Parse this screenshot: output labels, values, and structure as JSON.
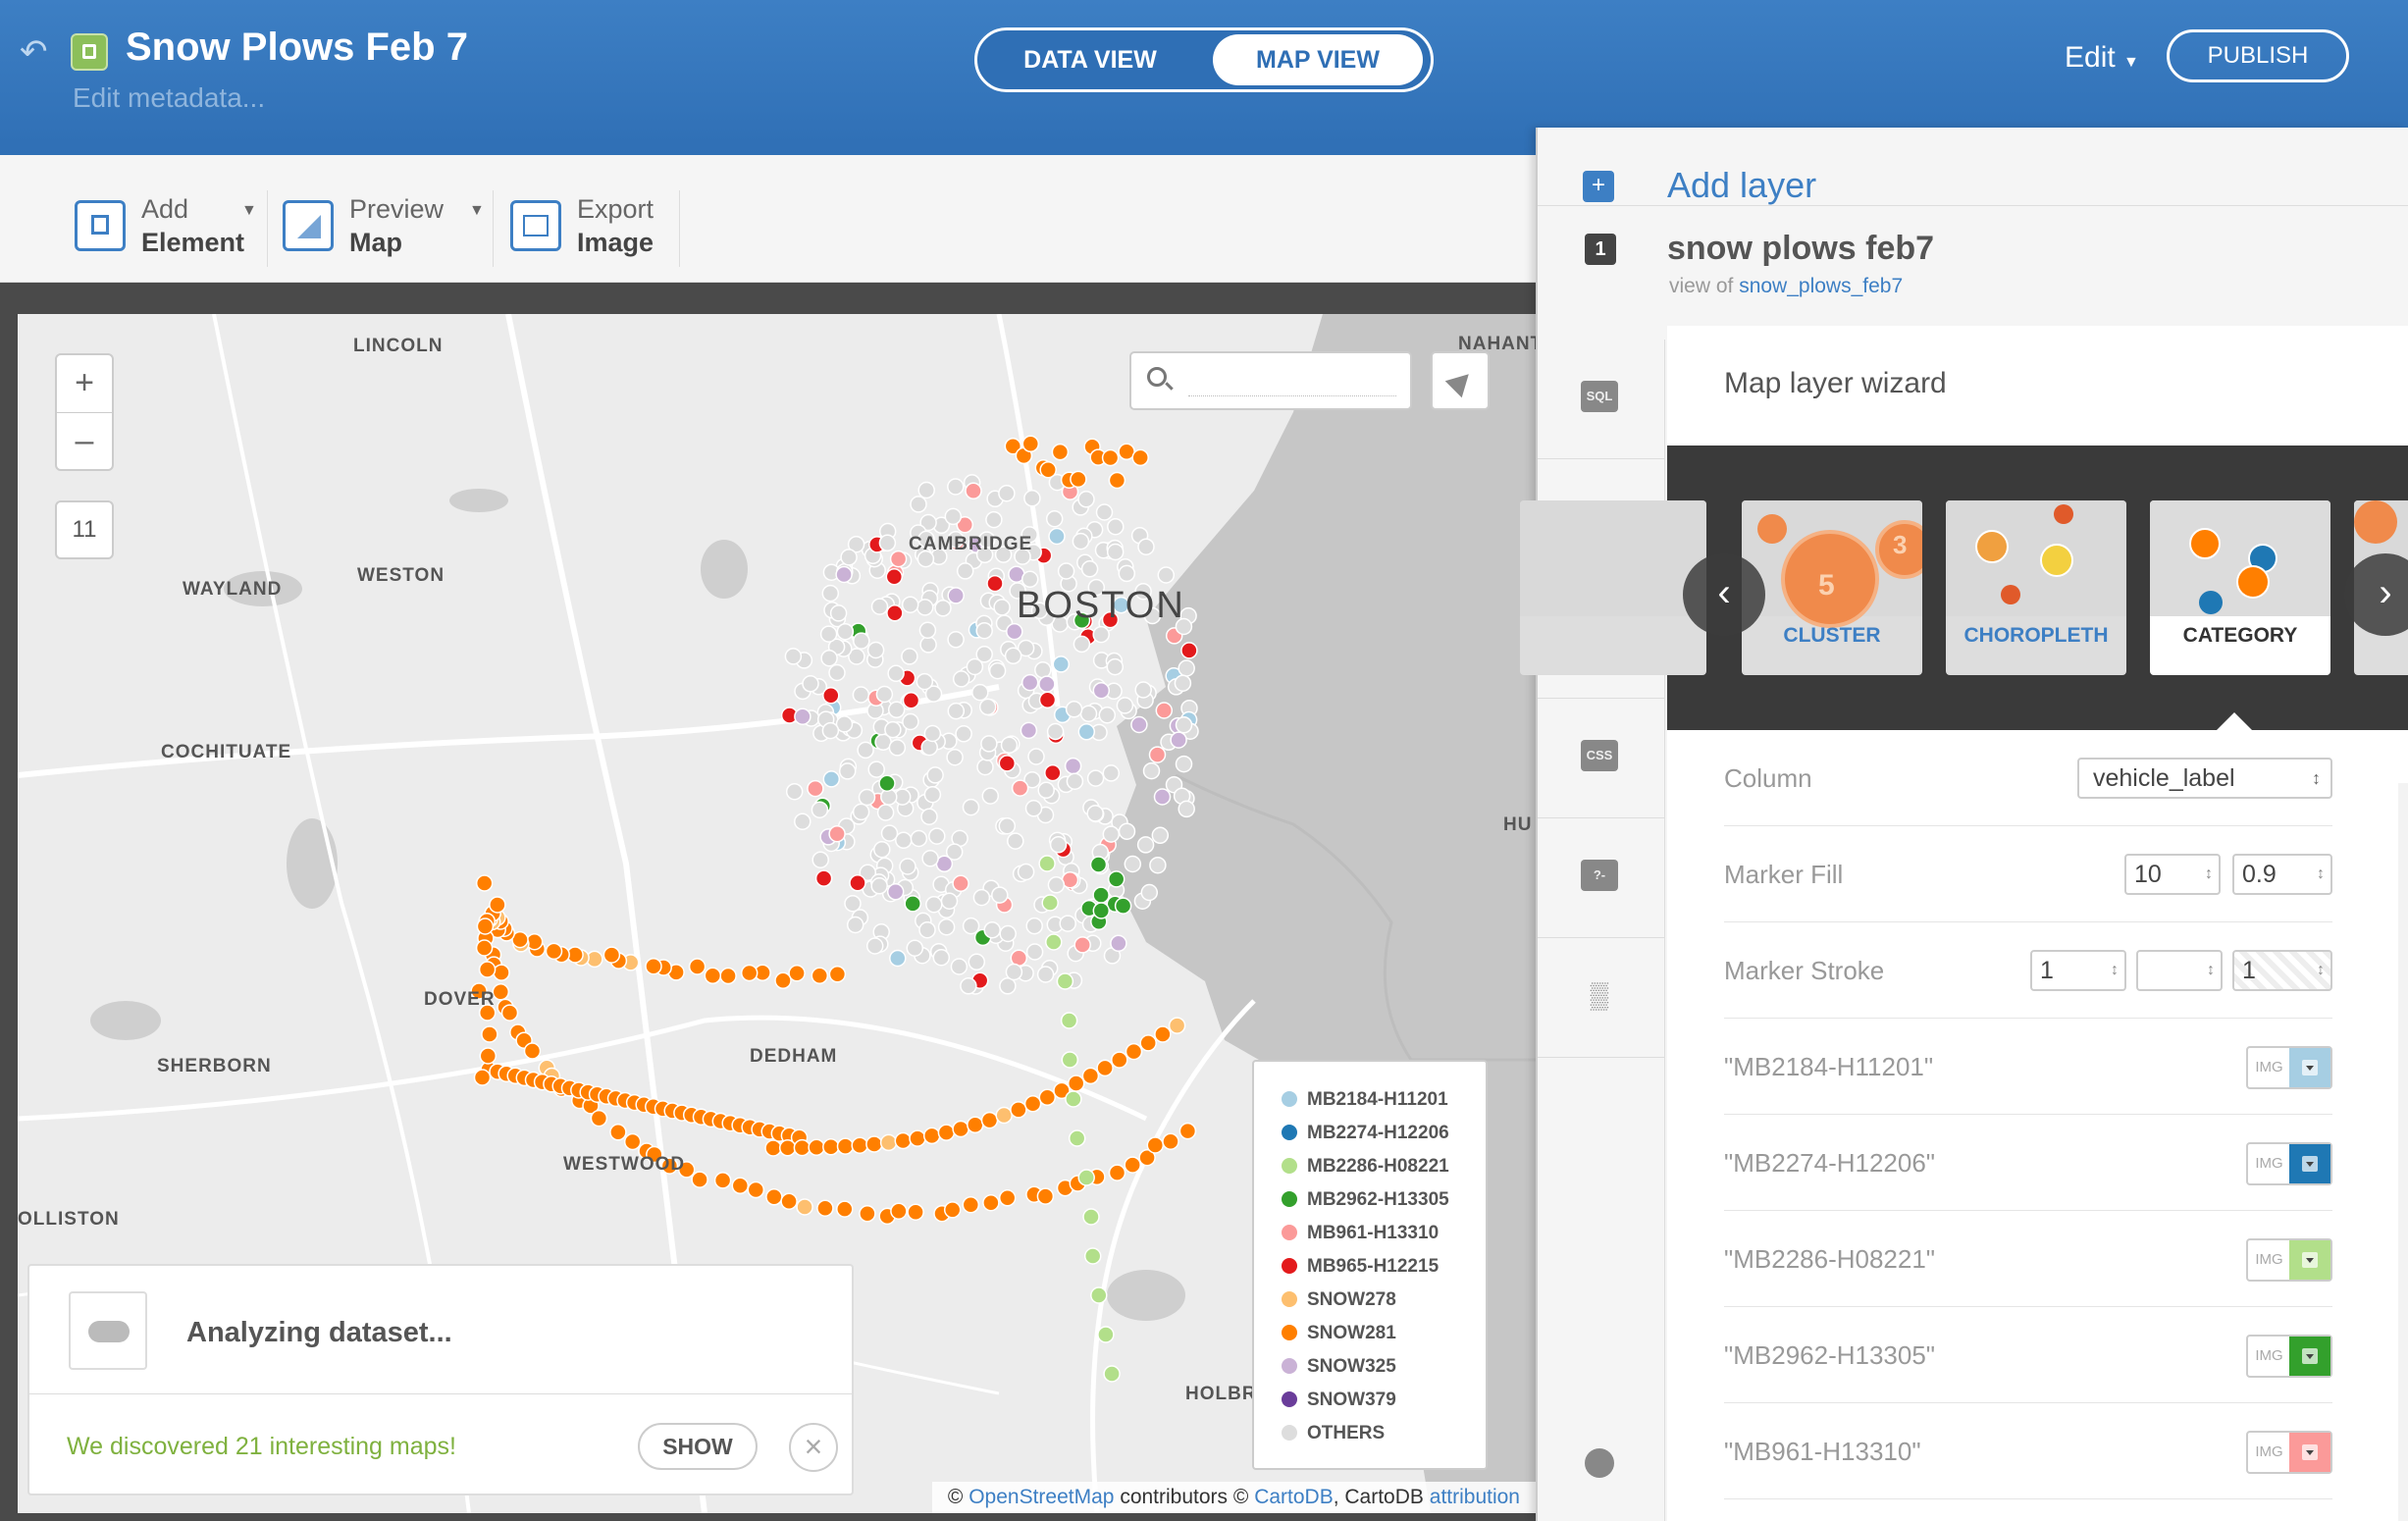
{
  "header": {
    "back_icon": "back-arrow-icon",
    "lock_icon": "lock-icon",
    "title": "Snow Plows Feb 7",
    "edit_metadata": "Edit metadata...",
    "views": {
      "data": "DATA VIEW",
      "map": "MAP VIEW",
      "active": "map"
    },
    "edit_menu": "Edit",
    "publish": "PUBLISH"
  },
  "toolbar": {
    "add_element": {
      "line1": "Add",
      "line2": "Element"
    },
    "preview_map": {
      "line1": "Preview",
      "line2": "Map"
    },
    "export_image": {
      "line1": "Export",
      "line2": "Image"
    }
  },
  "map": {
    "zoom_in": "+",
    "zoom_out": "–",
    "zoom_level": "11",
    "search_placeholder": "",
    "places": {
      "lincoln": "LINCOLN",
      "nahant": "NAHANT",
      "cambridge": "CAMBRIDGE",
      "boston": "BOSTON",
      "wayland": "WAYLAND",
      "weston": "WESTON",
      "cochituate": "COCHITUATE",
      "hu": "HU",
      "dover": "DOVER",
      "sherborn": "SHERBORN",
      "dedham": "DEDHAM",
      "westwood": "WESTWOOD",
      "olliston": "OLLISTON",
      "holbr": "HOLBR"
    },
    "legend": [
      {
        "label": "MB2184-H11201",
        "color": "#a6cee3"
      },
      {
        "label": "MB2274-H12206",
        "color": "#1f78b4"
      },
      {
        "label": "MB2286-H08221",
        "color": "#b2df8a"
      },
      {
        "label": "MB2962-H13305",
        "color": "#33a02c"
      },
      {
        "label": "MB961-H13310",
        "color": "#fb9a99"
      },
      {
        "label": "MB965-H12215",
        "color": "#e31a1c"
      },
      {
        "label": "SNOW278",
        "color": "#fdbf6f"
      },
      {
        "label": "SNOW281",
        "color": "#ff7f00"
      },
      {
        "label": "SNOW325",
        "color": "#cab2d6"
      },
      {
        "label": "SNOW379",
        "color": "#6a3d9a"
      },
      {
        "label": "OTHERS",
        "color": "#dddddd"
      }
    ],
    "attribution": {
      "prefix": "©",
      "osm": "OpenStreetMap",
      "mid": "contributors ©",
      "cartodb": "CartoDB",
      "tail": ", CartoDB",
      "attr": "attribution"
    }
  },
  "analyzing": {
    "cloud_icon": "cloud-icon",
    "title": "Analyzing dataset...",
    "found": "We discovered 21 interesting maps!",
    "show": "SHOW",
    "close": "×"
  },
  "panel": {
    "add_layer": "Add layer",
    "layer_number": "1",
    "layer_name": "snow plows feb7",
    "view_of": "view of",
    "source_table": "snow_plows_feb7",
    "side_icons": [
      "sql-icon",
      "wizard-brush-icon",
      "infowindow-icon",
      "css-icon",
      "legend-icon",
      "filters-chart-icon"
    ],
    "side_labels": [
      "SQL",
      "",
      "",
      "CSS",
      "",
      ""
    ],
    "bottom_icon": "lightbulb-icon",
    "wizard": {
      "title": "Map layer wizard",
      "types": [
        "CLUSTER",
        "CHOROPLETH",
        "CATEGORY"
      ],
      "selected": "CATEGORY",
      "cluster_numbers": [
        "5",
        "3"
      ],
      "column_label": "Column",
      "column_value": "vehicle_label",
      "marker_fill_label": "Marker Fill",
      "marker_fill_width": "10",
      "marker_fill_opacity": "0.9",
      "marker_stroke_label": "Marker Stroke",
      "marker_stroke_width": "1",
      "marker_stroke_opacity": "1",
      "img_label": "IMG",
      "categories": [
        {
          "label": "\"MB2184-H11201\"",
          "color": "#a6cee3"
        },
        {
          "label": "\"MB2274-H12206\"",
          "color": "#1f78b4"
        },
        {
          "label": "\"MB2286-H08221\"",
          "color": "#b2df8a"
        },
        {
          "label": "\"MB2962-H13305\"",
          "color": "#33a02c"
        },
        {
          "label": "\"MB961-H13310\"",
          "color": "#fb9a99"
        }
      ]
    }
  }
}
